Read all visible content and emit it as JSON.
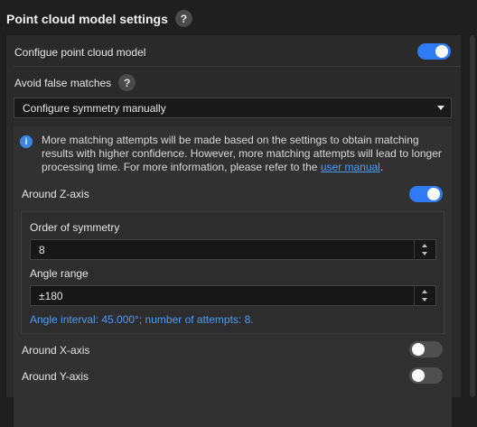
{
  "header": {
    "title": "Point cloud model settings",
    "help_glyph": "?"
  },
  "settings": {
    "configure_label": "Configue point cloud model",
    "configure_toggle": true,
    "avoid_label": "Avoid false matches",
    "avoid_help_glyph": "?",
    "symmetry_select": {
      "value": "Configure symmetry manually"
    },
    "info": {
      "icon_glyph": "i",
      "text": "More matching attempts will be made based on the settings to obtain matching results with higher confidence. However, more matching attempts will lead to longer processing time. For more information, please refer to the ",
      "link_text": "user manual",
      "trailing": "."
    },
    "z_axis": {
      "label": "Around Z-axis",
      "enabled": true,
      "order_label": "Order of symmetry",
      "order_value": "8",
      "angle_label": "Angle range",
      "angle_value": "±180",
      "hint": "Angle interval: 45.000°; number of attempts: 8."
    },
    "x_axis": {
      "label": "Around X-axis",
      "enabled": false
    },
    "y_axis": {
      "label": "Around Y-axis",
      "enabled": false
    }
  },
  "colors": {
    "accent": "#2f7bf5",
    "link": "#4d9cf5",
    "background": "#1f1f1f",
    "panel": "#2a2a2a"
  }
}
